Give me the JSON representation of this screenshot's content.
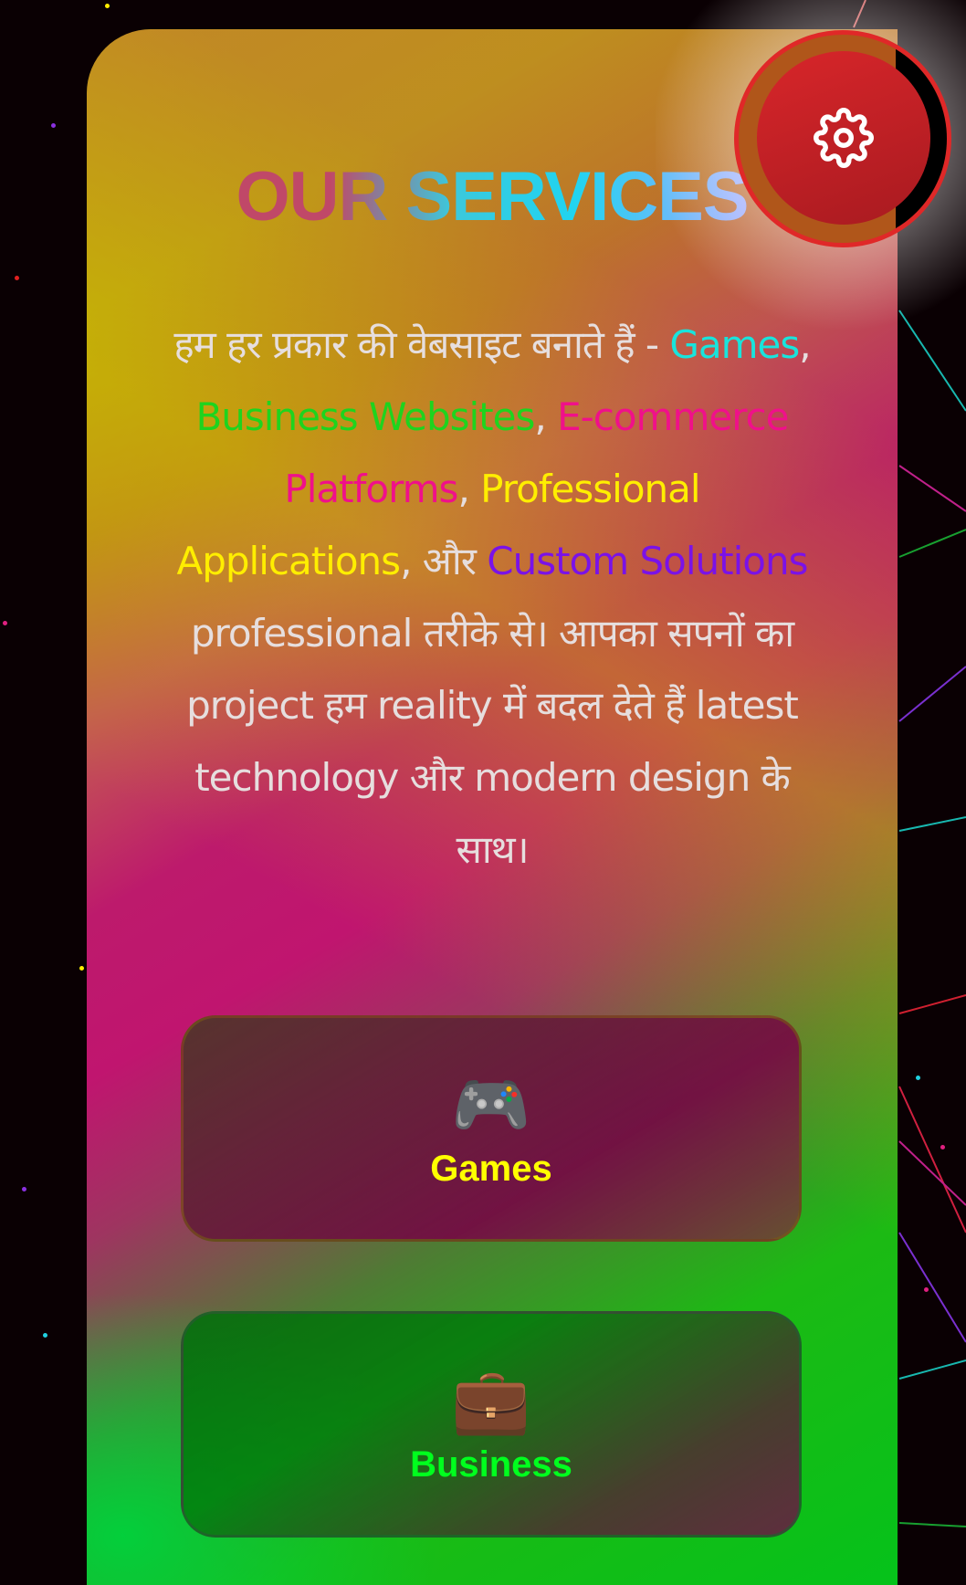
{
  "section": {
    "title_part1": "OUR",
    "title_part2": "SERVICES",
    "description": {
      "intro": "हम हर प्रकार की वेबसाइट बनाते हैं - ",
      "games": "Games",
      "sep1": ", ",
      "business": "Business Websites",
      "sep2": ", ",
      "ecommerce": "E-commerce Platforms",
      "sep3": ", ",
      "professional": "Professional Applications",
      "sep4": ", और ",
      "custom": "Custom Solutions",
      "outro": " professional तरीके से। आपका सपनों का project हम reality में बदल देते हैं latest technology और modern design के साथ।"
    }
  },
  "services": [
    {
      "icon": "🎮",
      "label": "Games"
    },
    {
      "icon": "💼",
      "label": "Business"
    }
  ],
  "settings_button": {
    "icon": "gear-icon"
  },
  "colors": {
    "games": "#19e4dc",
    "business": "#1ed41e",
    "ecommerce": "#f0108a",
    "professional": "#ffee00",
    "custom": "#7a12e8",
    "accent": "#e02828"
  }
}
